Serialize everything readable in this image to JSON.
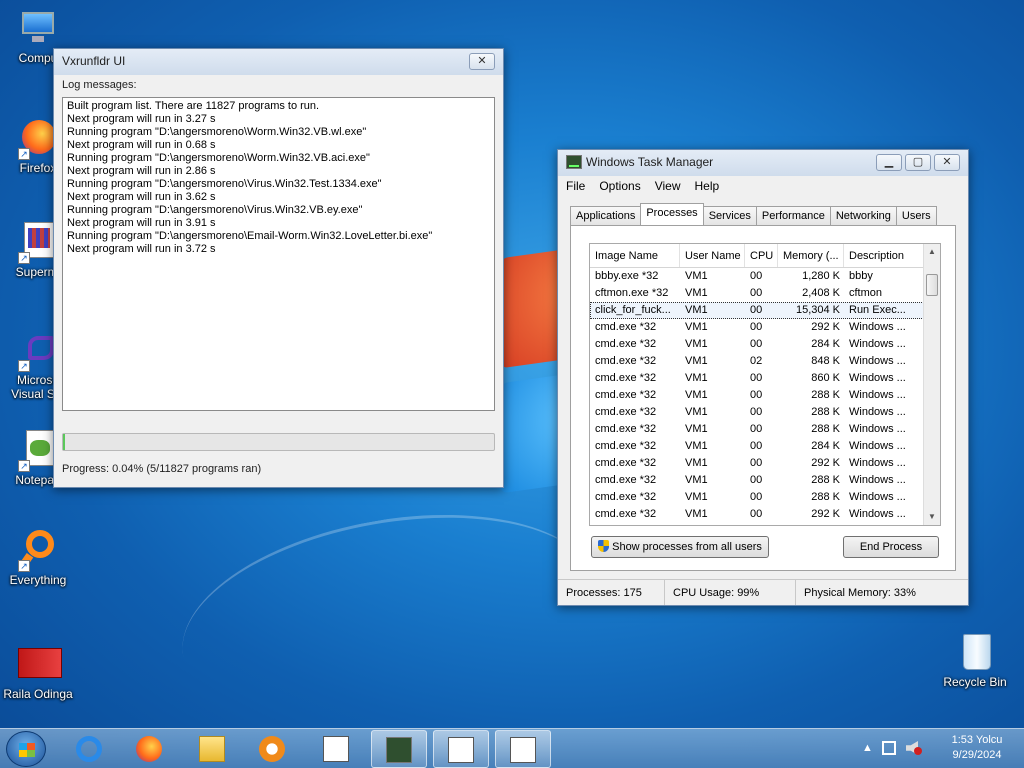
{
  "desktop": {
    "icons": [
      {
        "label": "Compu",
        "icon": "computer-icon"
      },
      {
        "label": "Firefox",
        "icon": "firefox-icon"
      },
      {
        "label": "Supermi",
        "icon": "super-mario-icon"
      },
      {
        "label": "Microso Visual Stu",
        "icon": "visual-studio-icon"
      },
      {
        "label": "Notepad",
        "icon": "notepad-icon"
      },
      {
        "label": "Everything",
        "icon": "everything-search-icon"
      },
      {
        "label": "Raila Odinga",
        "icon": "image-file-icon"
      },
      {
        "label": "Recycle Bin",
        "icon": "recycle-bin-icon"
      }
    ]
  },
  "vx_window": {
    "title": "Vxrunfldr UI",
    "close": "✕",
    "log_label": "Log messages:",
    "log_lines": [
      "Built program list. There are 11827 programs to run.",
      "Next program will run in 3.27 s",
      "Running program \"D:\\angersmoreno\\Worm.Win32.VB.wl.exe\"",
      "Next program will run in 0.68 s",
      "Running program \"D:\\angersmoreno\\Worm.Win32.VB.aci.exe\"",
      "Next program will run in 2.86 s",
      "Running program \"D:\\angersmoreno\\Virus.Win32.Test.1334.exe\"",
      "Next program will run in 3.62 s",
      "Running program \"D:\\angersmoreno\\Virus.Win32.VB.ey.exe\"",
      "Next program will run in 3.91 s",
      "Running program \"D:\\angersmoreno\\Email-Worm.Win32.LoveLetter.bi.exe\"",
      "Next program will run in 3.72 s"
    ],
    "progress_fraction": 0.0004,
    "progress_text": "Progress: 0.04% (5/11827 programs ran)"
  },
  "task_manager": {
    "title": "Windows Task Manager",
    "minimize": "▁",
    "maximize": "▢",
    "close": "✕",
    "menu": [
      "File",
      "Options",
      "View",
      "Help"
    ],
    "tabs": [
      "Applications",
      "Processes",
      "Services",
      "Performance",
      "Networking",
      "Users"
    ],
    "active_tab": "Processes",
    "columns": [
      "Image Name",
      "User Name",
      "CPU",
      "Memory (...",
      "Description"
    ],
    "rows": [
      [
        "bbby.exe *32",
        "VM1",
        "00",
        "1,280 K",
        "bbby"
      ],
      [
        "cftmon.exe *32",
        "VM1",
        "00",
        "2,408 K",
        "cftmon"
      ],
      [
        "click_for_fuck...",
        "VM1",
        "00",
        "15,304 K",
        "Run Exec..."
      ],
      [
        "cmd.exe *32",
        "VM1",
        "00",
        "292 K",
        "Windows ..."
      ],
      [
        "cmd.exe *32",
        "VM1",
        "00",
        "284 K",
        "Windows ..."
      ],
      [
        "cmd.exe *32",
        "VM1",
        "02",
        "848 K",
        "Windows ..."
      ],
      [
        "cmd.exe *32",
        "VM1",
        "00",
        "860 K",
        "Windows ..."
      ],
      [
        "cmd.exe *32",
        "VM1",
        "00",
        "288 K",
        "Windows ..."
      ],
      [
        "cmd.exe *32",
        "VM1",
        "00",
        "288 K",
        "Windows ..."
      ],
      [
        "cmd.exe *32",
        "VM1",
        "00",
        "288 K",
        "Windows ..."
      ],
      [
        "cmd.exe *32",
        "VM1",
        "00",
        "284 K",
        "Windows ..."
      ],
      [
        "cmd.exe *32",
        "VM1",
        "00",
        "292 K",
        "Windows ..."
      ],
      [
        "cmd.exe *32",
        "VM1",
        "00",
        "288 K",
        "Windows ..."
      ],
      [
        "cmd.exe *32",
        "VM1",
        "00",
        "288 K",
        "Windows ..."
      ],
      [
        "cmd.exe *32",
        "VM1",
        "00",
        "292 K",
        "Windows ..."
      ]
    ],
    "selected_row": 2,
    "show_all_button": "Show processes from all users",
    "end_process_button": "End Process",
    "status": {
      "processes": "Processes: 175",
      "cpu": "CPU Usage: 99%",
      "memory": "Physical Memory: 33%"
    }
  },
  "taskbar": {
    "apps": [
      {
        "icon": "internet-explorer-icon",
        "open": false
      },
      {
        "icon": "firefox-icon",
        "open": false
      },
      {
        "icon": "file-explorer-icon",
        "open": false
      },
      {
        "icon": "media-player-icon",
        "open": false
      },
      {
        "icon": "document-app-icon",
        "open": false
      },
      {
        "icon": "task-manager-icon",
        "open": true
      },
      {
        "icon": "document-app-icon",
        "open": true
      },
      {
        "icon": "document-app-icon",
        "open": true
      }
    ],
    "tray_arrow": "▲",
    "clock_time": "1:53 Yolcu",
    "clock_date": "9/29/2024"
  }
}
